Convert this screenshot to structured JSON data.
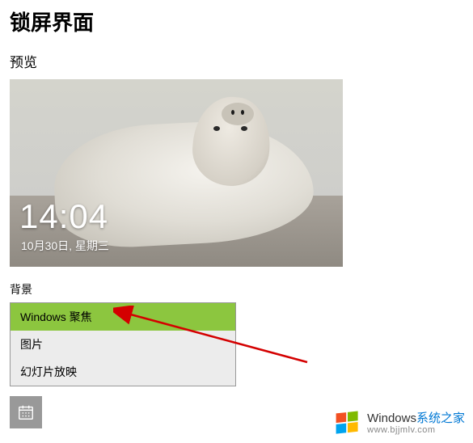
{
  "page": {
    "title": "锁屏界面",
    "preview_label": "预览",
    "background_label": "背景"
  },
  "preview": {
    "time": "14:04",
    "date": "10月30日, 星期三"
  },
  "dropdown": {
    "options": [
      "Windows 聚焦",
      "图片",
      "幻灯片放映"
    ],
    "selected_index": 0
  },
  "watermark": {
    "brand_en": "Windows",
    "brand_cn": "系统之家",
    "url": "www.bjjmlv.com"
  }
}
